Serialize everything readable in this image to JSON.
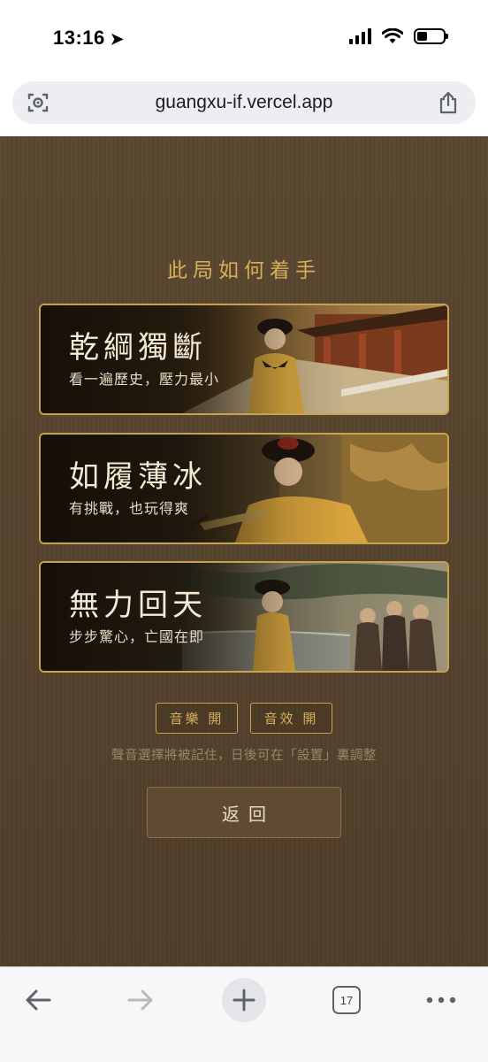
{
  "status_bar": {
    "time": "13:16"
  },
  "browser": {
    "url": "guangxu-if.vercel.app",
    "tab_count": "17"
  },
  "page": {
    "title": "此局如何着手",
    "options": [
      {
        "title": "乾綱獨斷",
        "subtitle": "看一遍歷史，壓力最小"
      },
      {
        "title": "如履薄冰",
        "subtitle": "有挑戰，也玩得爽"
      },
      {
        "title": "無力回天",
        "subtitle": "步步驚心，亡國在即"
      }
    ],
    "music_toggle": "音樂 開",
    "sfx_toggle": "音效 開",
    "hint": "聲音選擇將被記住，日後可在「設置」裏調整",
    "back_button": "返回"
  },
  "colors": {
    "gold": "#d7ae58",
    "page_bg": "#57442f",
    "card_border": "#c9a251"
  }
}
